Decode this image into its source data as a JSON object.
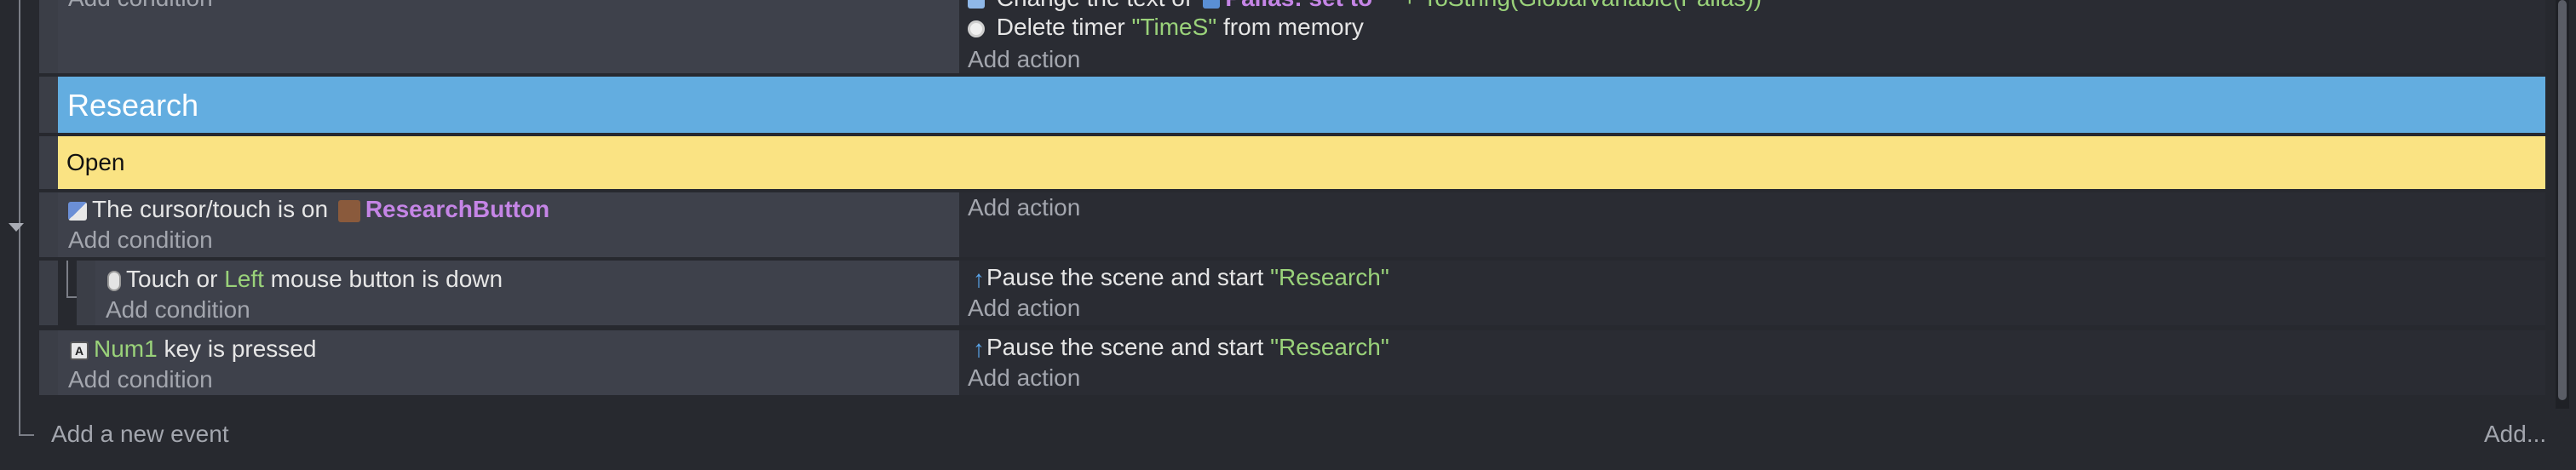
{
  "prev_event": {
    "add_condition": "Add condition",
    "action_change_text": "Change the text of",
    "action_object": "Pallas:",
    "action_set_to": "set to",
    "action_expr": "\"\" + ToString(GlobalVariable(Pallas))",
    "action_delete_timer": "Delete timer",
    "action_timer_name": "\"TimeS\"",
    "action_from_memory": "from memory",
    "add_action": "Add action"
  },
  "group": {
    "title": "Research"
  },
  "comment": {
    "text": "Open"
  },
  "event1": {
    "cond_prefix": "The cursor/touch is on",
    "cond_object": "ResearchButton",
    "add_condition": "Add condition",
    "add_action": "Add action",
    "sub": {
      "cond_prefix": "Touch or",
      "cond_button": "Left",
      "cond_suffix": "mouse button is down",
      "add_condition": "Add condition",
      "action_text": "Pause the scene and start",
      "action_scene": "\"Research\"",
      "add_action": "Add action"
    }
  },
  "event2": {
    "cond_key": "Num1",
    "cond_suffix": "key is pressed",
    "add_condition": "Add condition",
    "action_text": "Pause the scene and start",
    "action_scene": "\"Research\"",
    "add_action": "Add action"
  },
  "footer": {
    "add_new_event": "Add a new event",
    "add_more": "Add..."
  },
  "colors": {
    "group_bg": "#63ade0",
    "comment_bg": "#fae383",
    "highlight_green": "#9ad27a",
    "highlight_purple": "#c585e6"
  }
}
